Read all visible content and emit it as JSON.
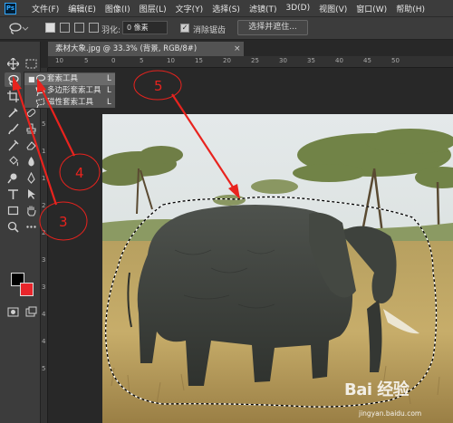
{
  "app": {
    "logo": "Ps",
    "menu": [
      "文件(F)",
      "编辑(E)",
      "图像(I)",
      "图层(L)",
      "文字(Y)",
      "选择(S)",
      "滤镜(T)",
      "3D(D)",
      "视图(V)",
      "窗口(W)",
      "帮助(H)"
    ]
  },
  "options": {
    "feather_label": "羽化:",
    "feather_value": "0 像素",
    "antialias_label": "消除锯齿",
    "antialias_checked": true,
    "select_mask_button": "选择并遮住..."
  },
  "document": {
    "tab_title": "素材大象.jpg @ 33.3% (背景, RGB/8#)",
    "tab_close": "×"
  },
  "rulers": {
    "top": [
      "10",
      "5",
      "0",
      "5",
      "10",
      "15",
      "20",
      "25",
      "30",
      "35",
      "40",
      "45",
      "50"
    ],
    "left": [
      "0",
      "5",
      "1",
      "1",
      "2",
      "2",
      "3",
      "3",
      "4",
      "4",
      "5"
    ]
  },
  "flyout": {
    "items": [
      {
        "label": "套索工具",
        "key": "L",
        "icon": "lasso-icon",
        "selected": true
      },
      {
        "label": "多边形套索工具",
        "key": "L",
        "icon": "polygonal-lasso-icon",
        "selected": false
      },
      {
        "label": "磁性套索工具",
        "key": "L",
        "icon": "magnetic-lasso-icon",
        "selected": false
      }
    ]
  },
  "annotations": [
    "3",
    "4",
    "5"
  ],
  "watermark": {
    "text": "Bai 经验",
    "subtext": "jingyan.baidu.com"
  },
  "colors": {
    "accent": "#31a8ff",
    "annotation": "#e8231e",
    "foreground": "#000000",
    "background": "#e8252b",
    "panel": "#3c3c3c",
    "canvas": "#282828"
  }
}
